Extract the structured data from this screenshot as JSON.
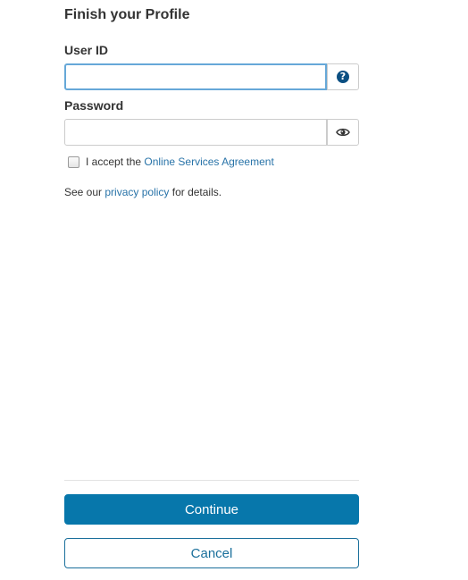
{
  "form": {
    "title": "Finish your Profile",
    "user_id": {
      "label": "User ID",
      "value": "",
      "placeholder": "",
      "help_icon": "question-circle-icon",
      "help_glyph": "?"
    },
    "password": {
      "label": "Password",
      "value": "",
      "placeholder": "",
      "toggle_icon": "eye-icon"
    },
    "agreement": {
      "checked": false,
      "prefix": "I accept the ",
      "link_text": "Online Services Agreement"
    },
    "privacy": {
      "prefix": "See our ",
      "link_text": "privacy policy",
      "suffix": " for details."
    }
  },
  "actions": {
    "continue_label": "Continue",
    "cancel_label": "Cancel"
  },
  "colors": {
    "primary": "#0777ab",
    "link": "#2873a8",
    "focus_border": "#66a8d8",
    "help_icon": "#0b4f82"
  }
}
